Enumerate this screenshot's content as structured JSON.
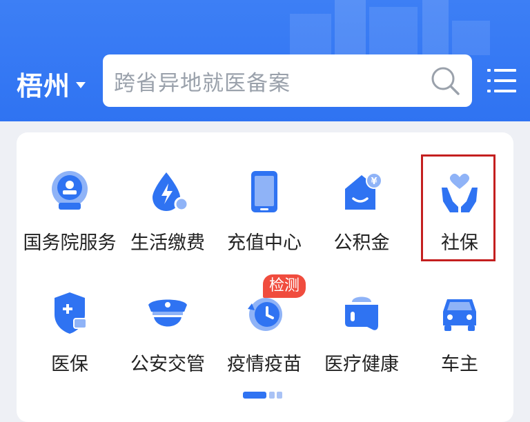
{
  "header": {
    "city": "梧州",
    "search_placeholder": "跨省异地就医备案"
  },
  "services": [
    {
      "label": "国务院服务",
      "icon": "state-council-icon"
    },
    {
      "label": "生活缴费",
      "icon": "utility-payment-icon"
    },
    {
      "label": "充值中心",
      "icon": "recharge-phone-icon"
    },
    {
      "label": "公积金",
      "icon": "housing-fund-icon"
    },
    {
      "label": "社保",
      "icon": "social-security-icon"
    },
    {
      "label": "医保",
      "icon": "medical-insurance-icon"
    },
    {
      "label": "公安交管",
      "icon": "police-traffic-icon"
    },
    {
      "label": "疫情疫苗",
      "icon": "epidemic-vaccine-icon"
    },
    {
      "label": "医疗健康",
      "icon": "medical-health-icon"
    },
    {
      "label": "车主",
      "icon": "car-owner-icon"
    }
  ],
  "badges": {
    "epidemic": "检测"
  },
  "colors": {
    "primary": "#2f73f2",
    "icon_light": "#8fb3f7",
    "badge": "#f04c3e",
    "highlight_border": "#c41f1f"
  }
}
